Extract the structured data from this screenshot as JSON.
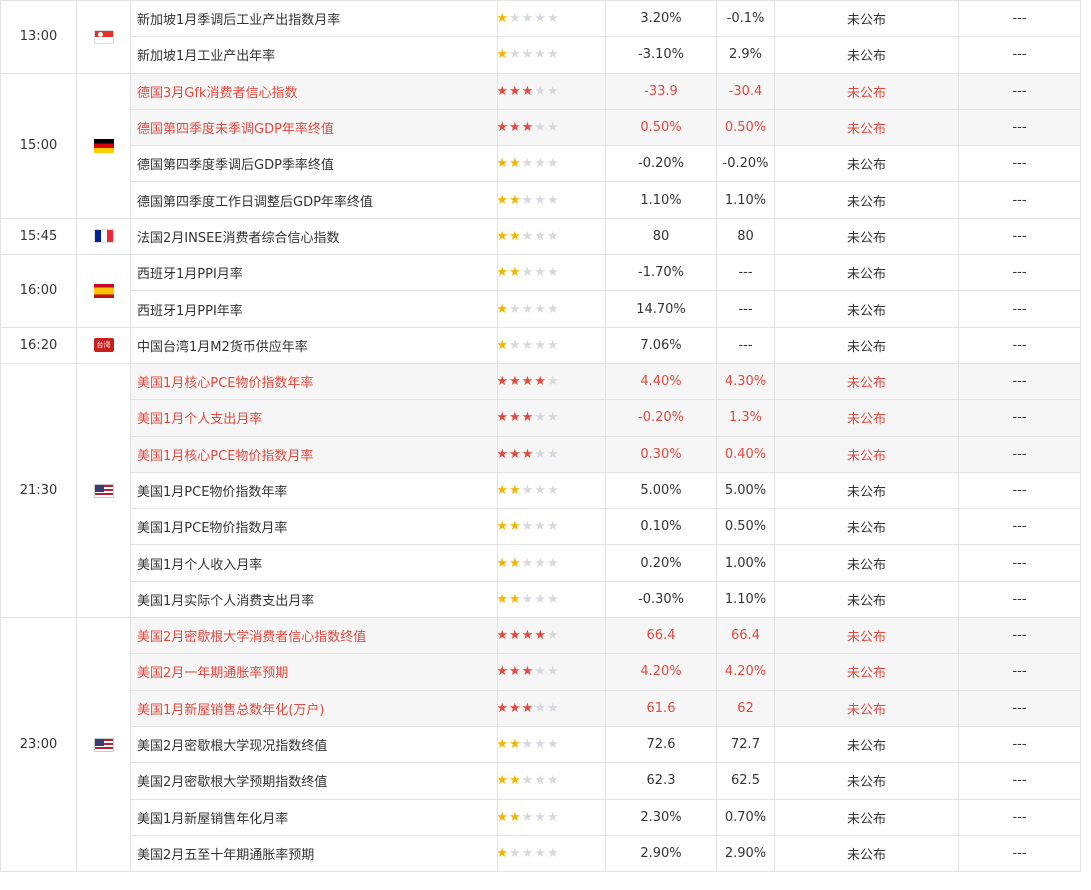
{
  "colors": {
    "highlight": "#e04a3f",
    "star_filled": "#f5b400",
    "star_empty": "#d6d9de",
    "chart_icon": "#4a90e2"
  },
  "empty_mark": "---",
  "groups": [
    {
      "time": "13:00",
      "flag": "sg",
      "flag_text": "",
      "rows": [
        {
          "name": "新加坡1月季调后工业产出指数月率",
          "stars": 1,
          "prev": "3.20%",
          "forecast": "-0.1%",
          "actual": "未公布",
          "hl": false
        },
        {
          "name": "新加坡1月工业产出年率",
          "stars": 1,
          "prev": "-3.10%",
          "forecast": "2.9%",
          "actual": "未公布",
          "hl": false
        }
      ]
    },
    {
      "time": "15:00",
      "flag": "de",
      "flag_text": "",
      "rows": [
        {
          "name": "德国3月Gfk消费者信心指数",
          "stars": 3,
          "prev": "-33.9",
          "forecast": "-30.4",
          "actual": "未公布",
          "hl": true
        },
        {
          "name": "德国第四季度未季调GDP年率终值",
          "stars": 3,
          "prev": "0.50%",
          "forecast": "0.50%",
          "actual": "未公布",
          "hl": true
        },
        {
          "name": "德国第四季度季调后GDP季率终值",
          "stars": 2,
          "prev": "-0.20%",
          "forecast": "-0.20%",
          "actual": "未公布",
          "hl": false
        },
        {
          "name": "德国第四季度工作日调整后GDP年率终值",
          "stars": 2,
          "prev": "1.10%",
          "forecast": "1.10%",
          "actual": "未公布",
          "hl": false
        }
      ]
    },
    {
      "time": "15:45",
      "flag": "fr",
      "flag_text": "",
      "rows": [
        {
          "name": "法国2月INSEE消费者综合信心指数",
          "stars": 2,
          "prev": "80",
          "forecast": "80",
          "actual": "未公布",
          "hl": false
        }
      ]
    },
    {
      "time": "16:00",
      "flag": "es",
      "flag_text": "",
      "rows": [
        {
          "name": "西班牙1月PPI月率",
          "stars": 2,
          "prev": "-1.70%",
          "forecast": "---",
          "actual": "未公布",
          "hl": false
        },
        {
          "name": "西班牙1月PPI年率",
          "stars": 1,
          "prev": "14.70%",
          "forecast": "---",
          "actual": "未公布",
          "hl": false
        }
      ]
    },
    {
      "time": "16:20",
      "flag": "tw",
      "flag_text": "台湾",
      "rows": [
        {
          "name": "中国台湾1月M2货币供应年率",
          "stars": 1,
          "prev": "7.06%",
          "forecast": "---",
          "actual": "未公布",
          "hl": false
        }
      ]
    },
    {
      "time": "21:30",
      "flag": "us",
      "flag_text": "",
      "rows": [
        {
          "name": "美国1月核心PCE物价指数年率",
          "stars": 4,
          "prev": "4.40%",
          "forecast": "4.30%",
          "actual": "未公布",
          "hl": true
        },
        {
          "name": "美国1月个人支出月率",
          "stars": 3,
          "prev": "-0.20%",
          "forecast": "1.3%",
          "actual": "未公布",
          "hl": true
        },
        {
          "name": "美国1月核心PCE物价指数月率",
          "stars": 3,
          "prev": "0.30%",
          "forecast": "0.40%",
          "actual": "未公布",
          "hl": true
        },
        {
          "name": "美国1月PCE物价指数年率",
          "stars": 2,
          "prev": "5.00%",
          "forecast": "5.00%",
          "actual": "未公布",
          "hl": false
        },
        {
          "name": "美国1月PCE物价指数月率",
          "stars": 2,
          "prev": "0.10%",
          "forecast": "0.50%",
          "actual": "未公布",
          "hl": false
        },
        {
          "name": "美国1月个人收入月率",
          "stars": 2,
          "prev": "0.20%",
          "forecast": "1.00%",
          "actual": "未公布",
          "hl": false
        },
        {
          "name": "美国1月实际个人消费支出月率",
          "stars": 2,
          "prev": "-0.30%",
          "forecast": "1.10%",
          "actual": "未公布",
          "hl": false
        }
      ]
    },
    {
      "time": "23:00",
      "flag": "us",
      "flag_text": "",
      "rows": [
        {
          "name": "美国2月密歇根大学消费者信心指数终值",
          "stars": 4,
          "prev": "66.4",
          "forecast": "66.4",
          "actual": "未公布",
          "hl": true
        },
        {
          "name": "美国2月一年期通胀率预期",
          "stars": 3,
          "prev": "4.20%",
          "forecast": "4.20%",
          "actual": "未公布",
          "hl": true
        },
        {
          "name": "美国1月新屋销售总数年化(万户)",
          "stars": 3,
          "prev": "61.6",
          "forecast": "62",
          "actual": "未公布",
          "hl": true
        },
        {
          "name": "美国2月密歇根大学现况指数终值",
          "stars": 2,
          "prev": "72.6",
          "forecast": "72.7",
          "actual": "未公布",
          "hl": false
        },
        {
          "name": "美国2月密歇根大学预期指数终值",
          "stars": 2,
          "prev": "62.3",
          "forecast": "62.5",
          "actual": "未公布",
          "hl": false
        },
        {
          "name": "美国1月新屋销售年化月率",
          "stars": 2,
          "prev": "2.30%",
          "forecast": "0.70%",
          "actual": "未公布",
          "hl": false
        },
        {
          "name": "美国2月五至十年期通胀率预期",
          "stars": 1,
          "prev": "2.90%",
          "forecast": "2.90%",
          "actual": "未公布",
          "hl": false
        }
      ]
    }
  ]
}
